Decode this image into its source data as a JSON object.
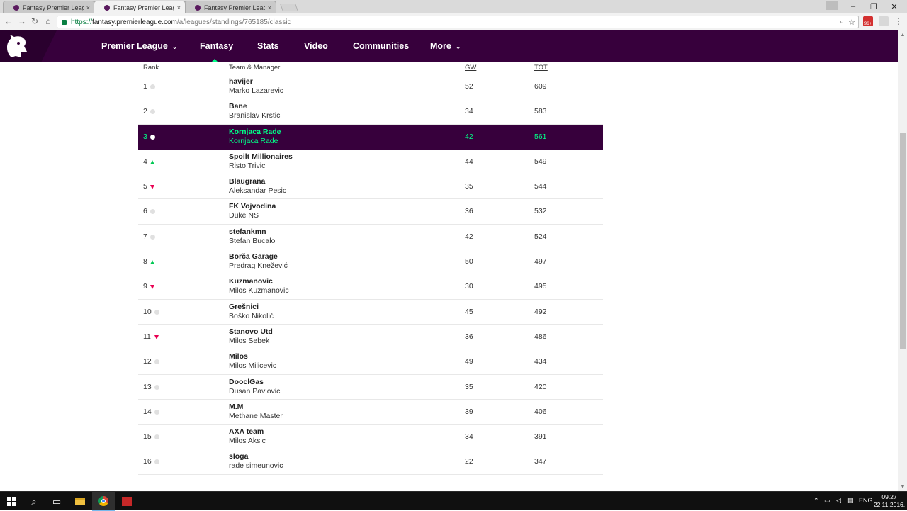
{
  "browser": {
    "tabs": [
      {
        "title": "Fantasy Premier League",
        "close": "×"
      },
      {
        "title": "Fantasy Premier League",
        "close": "×"
      },
      {
        "title": "Fantasy Premier League",
        "close": "×"
      }
    ],
    "window_controls": {
      "minimize": "–",
      "restore": "❐",
      "close": "✕"
    },
    "nav": {
      "back": "←",
      "forward": "→",
      "reload": "↻",
      "home": "⌂"
    },
    "url": {
      "protocol": "https://",
      "host": "fantasy.premierleague.com",
      "path": "/a/leagues/standings/765185/classic"
    },
    "extension_badge": "96+",
    "menu_icon": "⋮"
  },
  "site_nav": {
    "items": [
      {
        "label": "Premier League",
        "chevron": "⌄"
      },
      {
        "label": "Fantasy"
      },
      {
        "label": "Stats"
      },
      {
        "label": "Video"
      },
      {
        "label": "Communities"
      },
      {
        "label": "More",
        "chevron": "⌄"
      }
    ],
    "active": "Fantasy",
    "brand_color": "#37003c",
    "accent_color": "#00ff87"
  },
  "standings": {
    "headers": {
      "rank": "Rank",
      "team": "Team & Manager",
      "gw": "GW",
      "tot": "TOT"
    },
    "rows": [
      {
        "rank": "1",
        "movement": "same",
        "team": "havijer",
        "manager": "Marko Lazarevic",
        "gw": "52",
        "tot": "609"
      },
      {
        "rank": "2",
        "movement": "same",
        "team": "Bane",
        "manager": "Branislav Krstic",
        "gw": "34",
        "tot": "583"
      },
      {
        "rank": "3",
        "movement": "same",
        "team": "Kornjaca Rade",
        "manager": "Kornjaca Rade",
        "gw": "42",
        "tot": "561",
        "highlighted": true
      },
      {
        "rank": "4",
        "movement": "up",
        "team": "Spoilt Millionaires",
        "manager": "Risto Trivic",
        "gw": "44",
        "tot": "549"
      },
      {
        "rank": "5",
        "movement": "down",
        "team": "Blaugrana",
        "manager": "Aleksandar Pesic",
        "gw": "35",
        "tot": "544"
      },
      {
        "rank": "6",
        "movement": "same",
        "team": "FK Vojvodina",
        "manager": "Duke NS",
        "gw": "36",
        "tot": "532"
      },
      {
        "rank": "7",
        "movement": "same",
        "team": "stefankmn",
        "manager": "Stefan Bucalo",
        "gw": "42",
        "tot": "524"
      },
      {
        "rank": "8",
        "movement": "up",
        "team": "Borča Garage",
        "manager": "Predrag Knežević",
        "gw": "50",
        "tot": "497"
      },
      {
        "rank": "9",
        "movement": "down",
        "team": "Kuzmanovic",
        "manager": "Milos Kuzmanovic",
        "gw": "30",
        "tot": "495"
      },
      {
        "rank": "10",
        "movement": "same",
        "team": "Grešnici",
        "manager": "Boško Nikolić",
        "gw": "45",
        "tot": "492"
      },
      {
        "rank": "11",
        "movement": "down",
        "team": "Stanovo Utd",
        "manager": "Milos Sebek",
        "gw": "36",
        "tot": "486"
      },
      {
        "rank": "12",
        "movement": "same",
        "team": "Milos",
        "manager": "Milos Milicevic",
        "gw": "49",
        "tot": "434"
      },
      {
        "rank": "13",
        "movement": "same",
        "team": "DooclGas",
        "manager": "Dusan Pavlovic",
        "gw": "35",
        "tot": "420"
      },
      {
        "rank": "14",
        "movement": "same",
        "team": "M.M",
        "manager": "Methane Master",
        "gw": "39",
        "tot": "406"
      },
      {
        "rank": "15",
        "movement": "same",
        "team": "AXA team",
        "manager": "Milos Aksic",
        "gw": "34",
        "tot": "391"
      },
      {
        "rank": "16",
        "movement": "same",
        "team": "sloga",
        "manager": "rade simeunovic",
        "gw": "22",
        "tot": "347"
      }
    ]
  },
  "taskbar": {
    "start_icon": "windows-icon",
    "language": "ENG",
    "time": "09.27",
    "date": "22.11.2016."
  }
}
